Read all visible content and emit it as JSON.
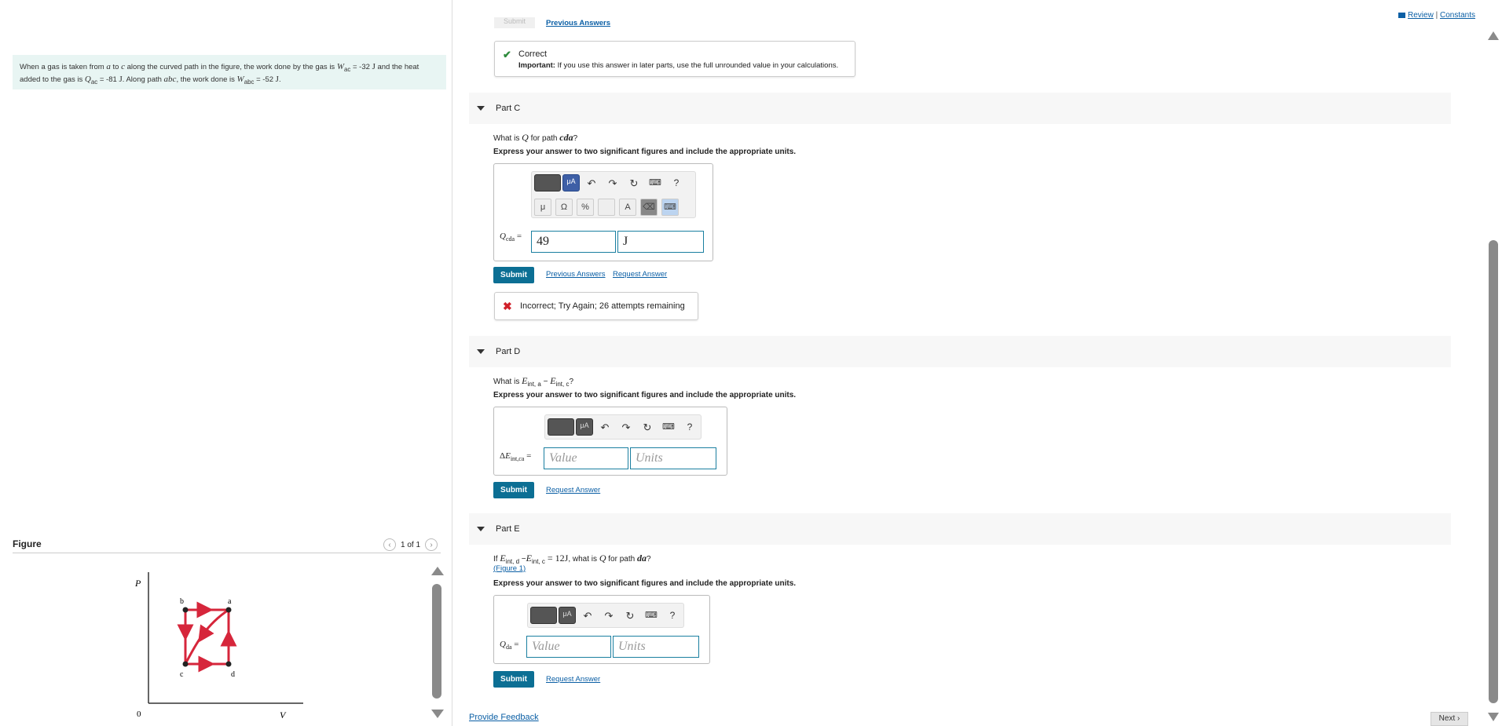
{
  "problem": {
    "text_1": "When a gas is taken from ",
    "a": "a",
    "text_2": " to ",
    "c": "c",
    "text_3": " along the curved path in the figure, the work done by the gas is ",
    "wac_sym": "W",
    "wac_sub": "ac",
    "wac_val": " = -32 ",
    "unit_j": "J",
    "text_4": " and the heat added to the gas is ",
    "qac_sym": "Q",
    "qac_sub": "ac",
    "qac_val": " = -81 ",
    "text_5": ". Along path ",
    "abc": "abc",
    "text_6": ", the work done is ",
    "wabc_sym": "W",
    "wabc_sub": "abc",
    "wabc_val": " = -52 ",
    "text_end": "."
  },
  "figure": {
    "title": "Figure",
    "pager": "1 of 1",
    "axis_p": "P",
    "axis_v": "V",
    "origin": "0",
    "labels": {
      "a": "a",
      "b": "b",
      "c": "c",
      "d": "d"
    },
    "line_color": "#d6263b"
  },
  "top_links": {
    "review": "Review",
    "sep": "|",
    "constants": "Constants"
  },
  "top": {
    "ghost_submit": "Submit",
    "prev_answers": "Previous Answers"
  },
  "correct_box": {
    "title": "Correct",
    "important_label": "Important:",
    "important_text": " If you use this answer in later parts, use the full unrounded value in your calculations."
  },
  "part_c": {
    "label": "Part C",
    "q_pre": "What is ",
    "q_sym": "Q",
    "q_mid": " for path ",
    "q_path": "cda",
    "q_end": "?",
    "instruction": "Express your answer to two significant figures and include the appropriate units.",
    "field_label_sym": "Q",
    "field_label_sub": "cda",
    "field_label_eq": " =",
    "value": "49",
    "units": "J",
    "submit": "Submit",
    "prev_answers": "Previous Answers",
    "request_answer": "Request Answer",
    "feedback": "Incorrect; Try Again; 26 attempts remaining",
    "tb_mu": "μ",
    "tb_ohm": "Ω",
    "tb_pct": "%",
    "tb_a": "A",
    "tb_q": "?",
    "tb_ua": "μA"
  },
  "part_d": {
    "label": "Part D",
    "q_pre": "What is ",
    "e1": "E",
    "e1_sub": "int, a",
    "minus": " − ",
    "e2": "E",
    "e2_sub": "int, c",
    "q_end": "?",
    "instruction": "Express your answer to two significant figures and include the appropriate units.",
    "field_label_pre": "Δ",
    "field_label_sym": "E",
    "field_label_sub": "int,ca",
    "field_label_eq": " =",
    "value_ph": "Value",
    "units_ph": "Units",
    "submit": "Submit",
    "request_answer": "Request Answer",
    "tb_q": "?",
    "tb_ua": "μA"
  },
  "part_e": {
    "label": "Part E",
    "q_if": "If ",
    "e1": "E",
    "e1_sub": "int, d",
    "minus": " −",
    "e2": "E",
    "e2_sub": "int, c",
    "eq": " = 12J",
    "q_mid": ", what is ",
    "q_sym": "Q",
    "q_for": " for path ",
    "q_path": "da",
    "q_end": "?",
    "figure_link": "(Figure 1)",
    "instruction": "Express your answer to two significant figures and include the appropriate units.",
    "field_label_sym": "Q",
    "field_label_sub": "da",
    "field_label_eq": " =",
    "value_ph": "Value",
    "units_ph": "Units",
    "submit": "Submit",
    "request_answer": "Request Answer",
    "tb_q": "?",
    "tb_ua": "μA"
  },
  "footer": {
    "provide_feedback": "Provide Feedback",
    "next": "Next ›"
  }
}
